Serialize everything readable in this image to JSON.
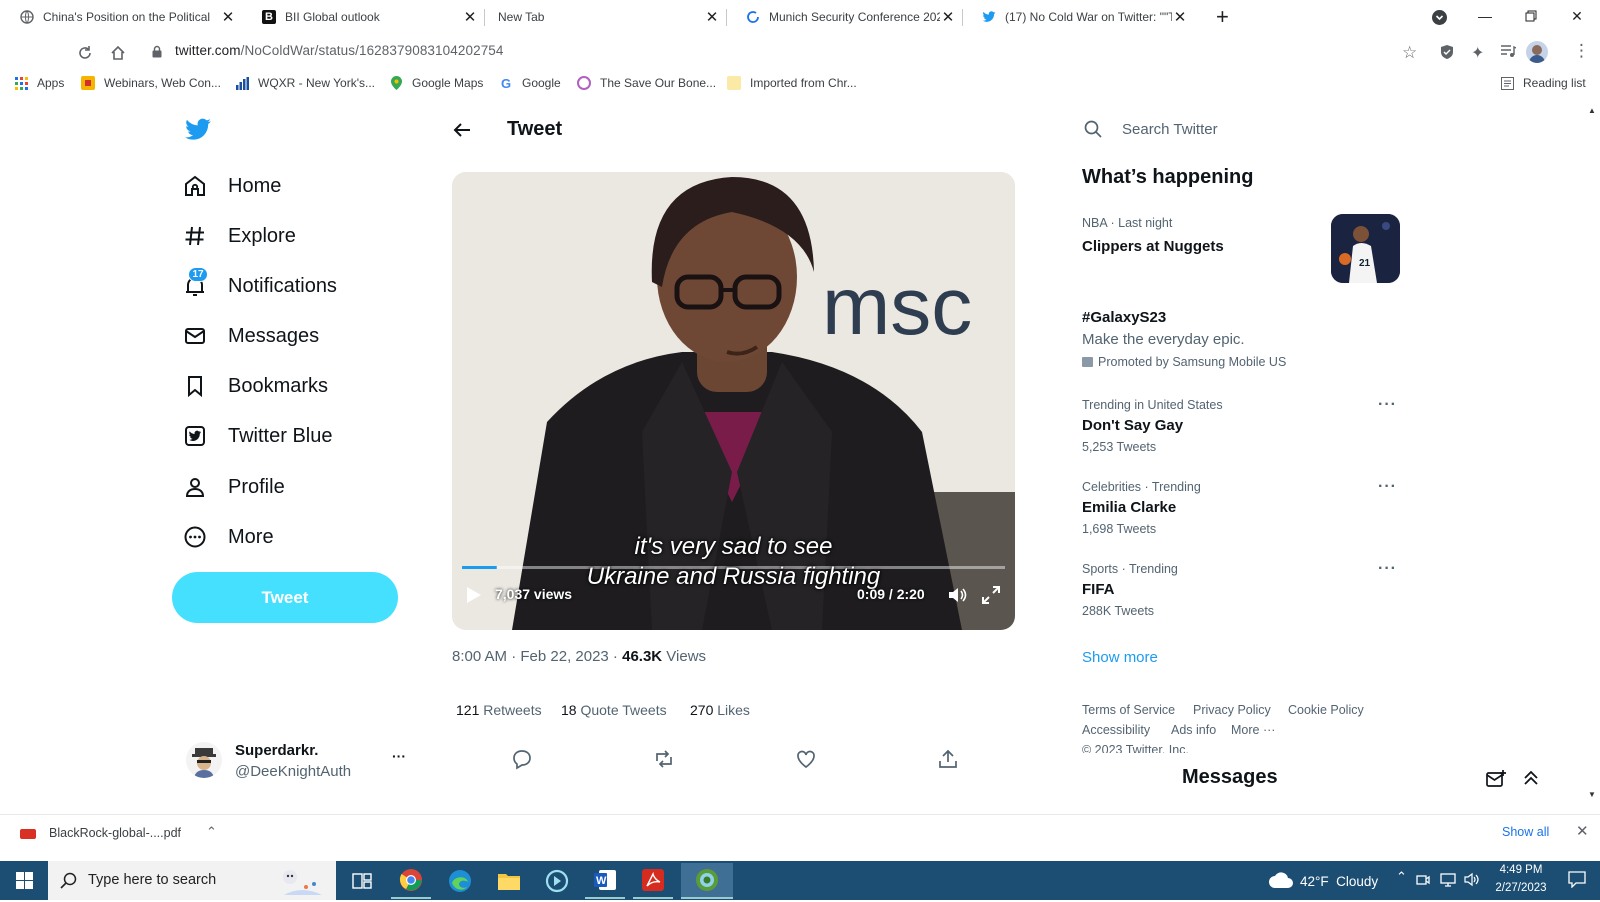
{
  "browser": {
    "tabs": [
      {
        "title": "China's Position on the Political",
        "icon": "globe-icon"
      },
      {
        "title": "BII Global outlook",
        "icon": "blackrock-b-icon"
      },
      {
        "title": "New Tab",
        "icon": "none"
      },
      {
        "title": "Munich Security Conference 202",
        "icon": "loading-icon"
      },
      {
        "title": "(17) No Cold War on Twitter: \"\"T",
        "icon": "twitter-bird-icon"
      }
    ],
    "new_tab_label": "+",
    "url_host": "twitter.com",
    "url_path": "/NoColdWar/status/1628379083104202754",
    "bookmarks": [
      {
        "label": "Apps",
        "icon": "apps-grid-icon"
      },
      {
        "label": "Webinars, Web Con...",
        "icon": "webinar-icon"
      },
      {
        "label": "WQXR - New York's...",
        "icon": "wqxr-bars-icon"
      },
      {
        "label": "Google Maps",
        "icon": "maps-pin-icon"
      },
      {
        "label": "Google",
        "icon": "google-g-icon"
      },
      {
        "label": "The Save Our Bone...",
        "icon": "bone-icon"
      },
      {
        "label": "Imported from Chr...",
        "icon": "folder-icon"
      }
    ],
    "reading_list_label": "Reading list"
  },
  "twitter": {
    "nav": [
      {
        "label": "Home",
        "icon": "home-icon"
      },
      {
        "label": "Explore",
        "icon": "hash-icon"
      },
      {
        "label": "Notifications",
        "icon": "bell-icon"
      },
      {
        "label": "Messages",
        "icon": "envelope-icon"
      },
      {
        "label": "Bookmarks",
        "icon": "bookmark-icon"
      },
      {
        "label": "Twitter Blue",
        "icon": "twitter-blue-icon"
      },
      {
        "label": "Profile",
        "icon": "person-icon"
      },
      {
        "label": "More",
        "icon": "more-circle-icon"
      }
    ],
    "notification_count": "17",
    "tweet_button": "Tweet",
    "account": {
      "name": "Superdarkr.",
      "handle": "@DeeKnightAuth",
      "menu": "···"
    },
    "header_title": "Tweet",
    "video": {
      "logo_text": "msc",
      "caption_line1": "it's very sad to see",
      "caption_line2": "Ukraine and Russia fighting",
      "views": "7,037 views",
      "time": "0:09 / 2:20",
      "progress_fraction": 0.064
    },
    "tweet_meta": {
      "time": "8:00 AM · Feb 22, 2023 · ",
      "views_count": "46.3K",
      "views_label": " Views"
    },
    "stats": [
      {
        "count": "121",
        "label": " Retweets"
      },
      {
        "count": "18",
        "label": " Quote Tweets"
      },
      {
        "count": "270",
        "label": " Likes"
      }
    ],
    "search_placeholder": "Search Twitter",
    "whats_happening": "What’s happening",
    "trends": [
      {
        "meta": "NBA · Last night",
        "title": "Clippers at Nuggets",
        "sub": ""
      },
      {
        "meta": "",
        "title": "#GalaxyS23",
        "sub": "Make the everyday epic.",
        "promo": "Promoted by Samsung Mobile US"
      },
      {
        "meta": "Trending in United States",
        "title": "Don't Say Gay",
        "sub": "5,253 Tweets"
      },
      {
        "meta": "Celebrities · Trending",
        "title": "Emilia Clarke",
        "sub": "1,698 Tweets"
      },
      {
        "meta": "Sports · Trending",
        "title": "FIFA",
        "sub": "288K Tweets"
      }
    ],
    "show_more": "Show more",
    "footer": [
      "Terms of Service",
      "Privacy Policy",
      "Cookie Policy",
      "Accessibility",
      "Ads info",
      "More ···",
      "© 2023 Twitter, Inc."
    ],
    "messages_drawer": "Messages"
  },
  "downloads": {
    "file": "BlackRock-global-....pdf",
    "show_all": "Show all"
  },
  "taskbar": {
    "search_placeholder": "Type here to search",
    "weather": "42°F  Cloudy",
    "time": "4:49 PM",
    "date": "2/27/2023"
  },
  "colors": {
    "twitter_blue": "#1d9bf0",
    "tweet_button": "#46e0ff",
    "taskbar": "#1c4e73"
  }
}
